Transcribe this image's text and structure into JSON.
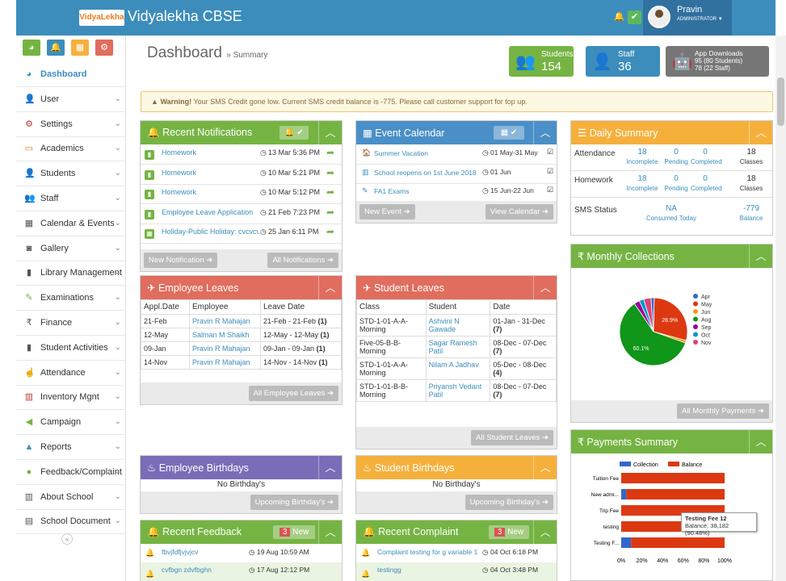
{
  "app": {
    "logo": "VidyaLekha",
    "title": "Vidyalekha CBSE",
    "user_name": "Pravin",
    "user_role": "ADMINISTRATOR ▼"
  },
  "sidebar": {
    "items": [
      {
        "label": "Dashboard",
        "icon": "dashboard-icon"
      },
      {
        "label": "User",
        "icon": "user-icon"
      },
      {
        "label": "Settings",
        "icon": "gear-icon"
      },
      {
        "label": "Academics",
        "icon": "laptop-icon"
      },
      {
        "label": "Students",
        "icon": "student-icon"
      },
      {
        "label": "Staff",
        "icon": "staff-icon"
      },
      {
        "label": "Calendar & Events",
        "icon": "calendar-icon"
      },
      {
        "label": "Gallery",
        "icon": "camera-icon"
      },
      {
        "label": "Library Management",
        "icon": "book-icon"
      },
      {
        "label": "Examinations",
        "icon": "pencil-icon"
      },
      {
        "label": "Finance",
        "icon": "rupee-icon"
      },
      {
        "label": "Student Activities",
        "icon": "book-icon"
      },
      {
        "label": "Attendance",
        "icon": "hand-icon"
      },
      {
        "label": "Inventory Mgnt",
        "icon": "inventory-icon"
      },
      {
        "label": "Campaign",
        "icon": "megaphone-icon"
      },
      {
        "label": "Reports",
        "icon": "area-chart-icon"
      },
      {
        "label": "Feedback/Complaint",
        "icon": "chat-icon"
      },
      {
        "label": "About School",
        "icon": "school-icon"
      },
      {
        "label": "School Document",
        "icon": "document-icon"
      }
    ]
  },
  "header": {
    "title": "Dashboard",
    "breadcrumb": "» Summary"
  },
  "stats": {
    "students_label": "Students",
    "students_value": "154",
    "staff_label": "Staff",
    "staff_value": "36",
    "app_label": "App Downloads",
    "app_line1": "95 (80 Students)",
    "app_line2": "78 (22 Staff)"
  },
  "warning": {
    "bold": "Warning!",
    "text": " Your SMS Credit gone low. Current SMS credit balance is -775. Please call customer support for top up."
  },
  "notifications": {
    "title": "Recent Notifications",
    "footer_new": "New Notification ➔",
    "footer_all": "All Notifications ➔",
    "items": [
      {
        "title": "Homework",
        "time": "13 Mar 5:36 PM"
      },
      {
        "title": "Homework",
        "time": "10 Mar 5:21 PM"
      },
      {
        "title": "Homework",
        "time": "10 Mar 5:12 PM"
      },
      {
        "title": "Employee Leave Application",
        "time": "21 Feb 7:23 PM"
      },
      {
        "title": "Holiday-Public Holiday: cvcvcv",
        "time": "25 Jan 6:11 PM"
      }
    ]
  },
  "events": {
    "title": "Event Calendar",
    "footer_new": "New Event ➔",
    "footer_view": "View Calendar ➔",
    "items": [
      {
        "title": "Summer Vacation",
        "date": "01 May-31 May"
      },
      {
        "title": "School reopens on 1st June 2018",
        "date": "01 Jun"
      },
      {
        "title": "FA1 Exams",
        "date": "15 Jun-22 Jun"
      }
    ]
  },
  "daily": {
    "title": "Daily Summary",
    "rows": [
      {
        "label": "Attendance",
        "a": "18",
        "b": "0",
        "c": "0",
        "d": "18",
        "al": "Incomplete",
        "bl": "Pending",
        "cl": "Completed",
        "dl": "Classes"
      },
      {
        "label": "Homework",
        "a": "18",
        "b": "0",
        "c": "0",
        "d": "18",
        "al": "Incomplete",
        "bl": "Pending",
        "cl": "Completed",
        "dl": "Classes"
      }
    ],
    "sms_label": "SMS Status",
    "sms_value": "NA",
    "sms_sub": "Consumed Today",
    "sms_bal": "-779",
    "sms_bal_label": "Balance"
  },
  "emp_leaves": {
    "title": "Employee Leaves",
    "headers": [
      "Appl.Date",
      "Employee",
      "Leave Date"
    ],
    "rows": [
      [
        "21-Feb",
        "Pravin R Mahajan",
        "21-Feb - 21-Feb",
        "(1)"
      ],
      [
        "12-May",
        "Salman M Shaikh",
        "12-May - 12-May",
        "(1)"
      ],
      [
        "09-Jan",
        "Pravin R Mahajan",
        "09-Jan - 09-Jan",
        "(1)"
      ],
      [
        "14-Nov",
        "Pravin R Mahajan",
        "14-Nov - 14-Nov",
        "(1)"
      ]
    ],
    "footer": "All Employee Leaves ➔"
  },
  "stu_leaves": {
    "title": "Student Leaves",
    "headers": [
      "Class",
      "Student",
      "Date"
    ],
    "rows": [
      [
        "STD-1-01-A-A-Morning",
        "Ashvini N Gawade",
        "01-Jan - 31-Dec",
        "(7)"
      ],
      [
        "Five-05-B-B-Morning",
        "Sagar Ramesh Patil",
        "08-Dec - 07-Dec",
        "(7)"
      ],
      [
        "STD-1-01-A-A-Morning",
        "Nilam A Jadhav",
        "05-Dec - 08-Dec",
        "(4)"
      ],
      [
        "STD-1-01-B-B-Morning",
        "Priyansh Vedant Patil",
        "08-Dec - 07-Dec",
        "(7)"
      ]
    ],
    "footer": "All Student Leaves ➔"
  },
  "monthly": {
    "title": "₹ Monthly Collections",
    "footer": "All Monthly Payments ➔"
  },
  "emp_bday": {
    "title": "Employee Birthdays",
    "text": "No Birthday's",
    "footer": "Upcoming Birthday's ➔"
  },
  "stu_bday": {
    "title": "Student Birthdays",
    "text": "No Birthday's",
    "footer": "Upcoming Birthday's ➔"
  },
  "feedback": {
    "title": "Recent Feedback",
    "badge": "3",
    "badge_label": "New",
    "items": [
      {
        "title": "fbvjfdfjvjvjcv",
        "time": "19 Aug 10:59 AM"
      },
      {
        "title": "cvfbgn zdvfbghn",
        "time": "17 Aug 12:12 PM"
      }
    ]
  },
  "complaint": {
    "title": "Recent Complaint",
    "badge": "3",
    "badge_label": "New",
    "items": [
      {
        "title": "Complaint testing for g variable 1",
        "time": "04 Oct 6:18 PM"
      },
      {
        "title": "testingg",
        "time": "04 Oct 3:48 PM"
      }
    ]
  },
  "payments": {
    "title": "₹ Payments Summary",
    "tooltip_title": "Testing Fee 12",
    "tooltip_text": "Balance: 38,182 (90.48%)"
  },
  "colors": {
    "primary": "#3c8dbc",
    "green": "#75b443",
    "red": "#e06d5e",
    "orange": "#f5b03c",
    "purple": "#7b6cb7"
  },
  "chart_data": [
    {
      "type": "pie",
      "legend": [
        "Apr",
        "May",
        "Jun",
        "Aug",
        "Sep",
        "Oct",
        "Nov"
      ],
      "colors": [
        "#3366cc",
        "#dc3912",
        "#ff9900",
        "#109618",
        "#990099",
        "#0099c6",
        "#dd4477"
      ],
      "values": [
        1.5,
        28.9,
        1.2,
        60.1,
        2.6,
        2.2,
        3.5
      ],
      "labels": {
        "May": "28.9%",
        "Aug": "60.1%"
      },
      "legend_position": "right"
    },
    {
      "type": "bar",
      "orientation": "horizontal",
      "stacked": true,
      "categories": [
        "Tuition Fee",
        "New admi...",
        "Trip Fee",
        "testing",
        "Testing F..."
      ],
      "series": [
        {
          "name": "Collection",
          "color": "#3366cc",
          "values": [
            0,
            5,
            0,
            0,
            9.5
          ]
        },
        {
          "name": "Balance",
          "color": "#dc3912",
          "values": [
            100,
            95,
            100,
            100,
            90.5
          ]
        }
      ],
      "xticks": [
        "0%",
        "20%",
        "40%",
        "60%",
        "80%",
        "100%"
      ],
      "xlim": [
        0,
        100
      ],
      "legend_position": "top"
    }
  ]
}
